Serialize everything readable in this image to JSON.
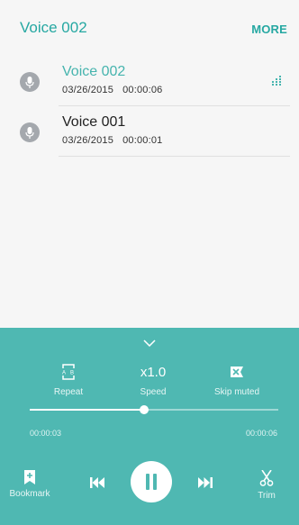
{
  "header": {
    "title": "Voice 002",
    "more_label": "MORE"
  },
  "recordings": [
    {
      "name": "Voice 002",
      "date": "03/26/2015",
      "duration": "00:00:06",
      "playing": true
    },
    {
      "name": "Voice 001",
      "date": "03/26/2015",
      "duration": "00:00:01",
      "playing": false
    }
  ],
  "player": {
    "repeat_label": "Repeat",
    "speed_value": "x1.0",
    "speed_label": "Speed",
    "skip_label": "Skip muted",
    "current_time": "00:00:03",
    "total_time": "00:00:06",
    "progress_fraction": 0.46,
    "bookmark_label": "Bookmark",
    "trim_label": "Trim"
  },
  "colors": {
    "accent": "#26a8a2",
    "player_bg": "#4fb8b2",
    "background": "#f6f6f6"
  },
  "icons": [
    "mic-icon",
    "equalizer-icon",
    "chevron-down-icon",
    "repeat-ab-icon",
    "skip-muted-icon",
    "bookmark-icon",
    "skip-previous-icon",
    "pause-icon",
    "skip-next-icon",
    "scissors-icon"
  ]
}
